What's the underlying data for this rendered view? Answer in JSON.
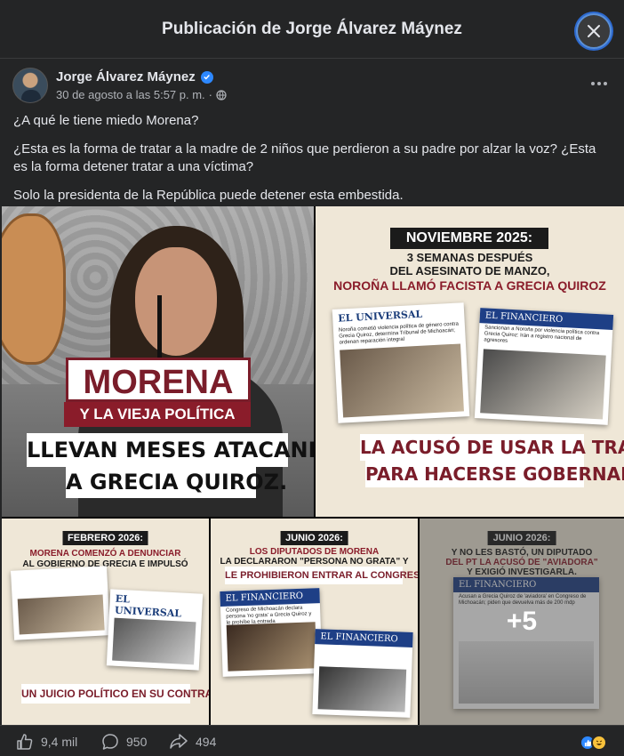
{
  "modal": {
    "title": "Publicación de Jorge Álvarez Máynez"
  },
  "post": {
    "author": "Jorge Álvarez Máynez",
    "timestamp": "30 de agosto a las 5:57 p. m.",
    "separator": "·",
    "paragraphs": [
      "¿A qué le tiene miedo Morena?",
      "¿Esta es la forma de tratar a la madre de 2 niños que perdieron a su padre por alzar la voz? ¿Esta es la forma detener tratar a una víctima?",
      "Solo la presidenta de la República puede detener esta embestida."
    ]
  },
  "images": {
    "tile1": {
      "line1": "MORENA",
      "line2": "Y LA VIEJA POLÍTICA",
      "line3": "LLEVAN MESES ATACANDO",
      "line4": "A GRECIA QUIROZ."
    },
    "tile2": {
      "heading": "NOVIEMBRE 2025:",
      "sub1": "3 SEMANAS DESPUÉS",
      "sub1b": "DEL ASESINATO DE MANZO,",
      "sub2": "NOROÑA LLAMÓ FACISTA A GRECIA QUIROZ",
      "clip1_mast": "EL UNIVERSAL",
      "clip1_text": "Noroña cometió violencia política de género contra Grecia Quiroz, determina Tribunal de Michoacán; ordenan reparación integral",
      "clip2_mast": "EL FINANCIERO",
      "clip2_text": "Sancionan a Noroña por violencia política contra Grecia Quiroz: Irán a registro nacional de agresores",
      "bottom1": "LA ACUSÓ DE USAR LA TRAGEDIA",
      "bottom2": "PARA HACERSE GOBERNADORA."
    },
    "tile3": {
      "heading": "FEBRERO 2026:",
      "line1": "MORENA COMENZÓ A DENUNCIAR",
      "line2": "AL GOBIERNO DE GRECIA E IMPULSÓ",
      "clip_mast": "EL UNIVERSAL",
      "bottom": "UN JUICIO POLÍTICO EN SU CONTRA."
    },
    "tile4": {
      "heading": "JUNIO 2026:",
      "line1": "LOS DIPUTADOS DE MORENA",
      "line2": "LA DECLARARON \"PERSONA NO GRATA\" Y",
      "bottom": "LE PROHIBIERON ENTRAR AL CONGRESO.",
      "clip1_mast": "EL FINANCIERO",
      "clip1_text": "Congreso de Michoacán declara persona 'no grata' a Grecia Quiroz y le prohíbe la entrada",
      "clip2_mast": "EL FINANCIERO"
    },
    "tile5": {
      "heading": "JUNIO 2026:",
      "line1": "Y NO LES BASTÓ, UN DIPUTADO",
      "line2": "DEL PT LA ACUSÓ DE \"AVIADORA\"",
      "line3": "Y EXIGIÓ INVESTIGARLA.",
      "clip_mast": "EL FINANCIERO",
      "clip_text": "Acusan a Grecia Quiroz de 'aviadora' en Congreso de Michoacán; piden que devuelva más de 200 mdp",
      "more_count": "+5"
    }
  },
  "footer": {
    "likes": "9,4 mil",
    "comments": "950",
    "shares": "494"
  },
  "colors": {
    "background": "#242526",
    "text": "#e4e6eb",
    "muted": "#b0b3b8",
    "accent": "#2d88ff",
    "brand_red": "#8a1c2a"
  }
}
